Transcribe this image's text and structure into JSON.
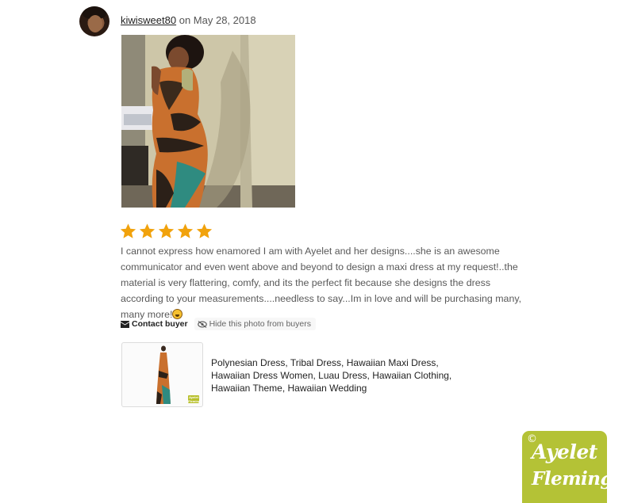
{
  "reviewer": {
    "username": "kiwisweet80",
    "date_text": "on May 28, 2018"
  },
  "review": {
    "rating": 5,
    "max_rating": 5,
    "text": "I cannot express how enamored I am with Ayelet and her designs....she is an awesome communicator and even went above and beyond to design a maxi dress at my request!..the material is very flattering, comfy, and its the perfect fit because she designs the dress according to your measurements....needless to say...Im in love and will be purchasing many, many more!"
  },
  "actions": {
    "contact_label": "Contact buyer",
    "hide_label": "Hide this photo from buyers"
  },
  "listing": {
    "title": "Polynesian Dress, Tribal Dress, Hawaiian Maxi Dress, Hawaiian Dress Women, Luau Dress, Hawaiian Clothing, Hawaiian Theme, Hawaiian Wedding",
    "badge_text": "Ayelet Fleming"
  },
  "watermark": {
    "copyright": "©",
    "line1": "Ayelet",
    "line2": "Fleming"
  },
  "colors": {
    "star": "#f1a20c",
    "watermark_bg": "#b4c236",
    "dress_orange": "#d27a36",
    "dress_teal": "#2f8b80"
  },
  "icons": {
    "avatar": "user-avatar-photo",
    "star": "star-icon",
    "contact": "envelope-icon",
    "hide": "eye-slash-icon"
  }
}
